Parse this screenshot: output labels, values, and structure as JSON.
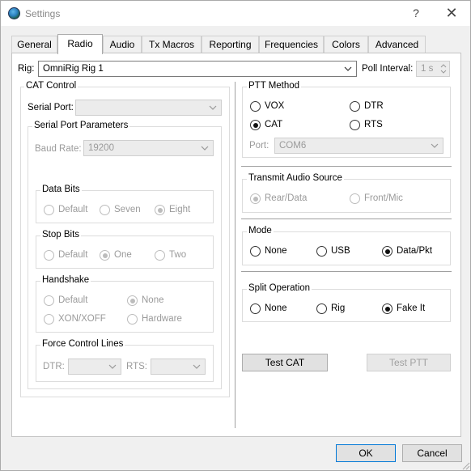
{
  "window": {
    "title": "Settings",
    "help_glyph": "?",
    "close_glyph": "✕",
    "icon": "globe-icon"
  },
  "tabs": [
    {
      "label": "General",
      "active": false
    },
    {
      "label": "Radio",
      "active": true
    },
    {
      "label": "Audio",
      "active": false
    },
    {
      "label": "Tx Macros",
      "active": false
    },
    {
      "label": "Reporting",
      "active": false
    },
    {
      "label": "Frequencies",
      "active": false
    },
    {
      "label": "Colors",
      "active": false
    },
    {
      "label": "Advanced",
      "active": false
    }
  ],
  "rig": {
    "label": "Rig:",
    "value": "OmniRig Rig 1",
    "poll_label": "Poll Interval:",
    "poll_value": "1 s"
  },
  "cat": {
    "title": "CAT Control",
    "serial_port_label": "Serial Port:",
    "serial_port_value": "",
    "params_title": "Serial Port Parameters",
    "baud_label": "Baud Rate:",
    "baud_value": "19200",
    "data_bits": {
      "title": "Data Bits",
      "options": [
        "Default",
        "Seven",
        "Eight"
      ],
      "selected": "Eight"
    },
    "stop_bits": {
      "title": "Stop Bits",
      "options": [
        "Default",
        "One",
        "Two"
      ],
      "selected": "One"
    },
    "handshake": {
      "title": "Handshake",
      "options": [
        "Default",
        "None",
        "XON/XOFF",
        "Hardware"
      ],
      "selected": "None"
    },
    "force": {
      "title": "Force Control Lines",
      "dtr_label": "DTR:",
      "rts_label": "RTS:",
      "dtr_value": "",
      "rts_value": ""
    }
  },
  "ptt": {
    "title": "PTT Method",
    "options": [
      "VOX",
      "DTR",
      "CAT",
      "RTS"
    ],
    "selected": "CAT",
    "port_label": "Port:",
    "port_value": "COM6"
  },
  "tx_audio": {
    "title": "Transmit Audio Source",
    "options": [
      "Rear/Data",
      "Front/Mic"
    ],
    "selected": "Rear/Data"
  },
  "mode": {
    "title": "Mode",
    "options": [
      "None",
      "USB",
      "Data/Pkt"
    ],
    "selected": "Data/Pkt"
  },
  "split": {
    "title": "Split Operation",
    "options": [
      "None",
      "Rig",
      "Fake It"
    ],
    "selected": "Fake It"
  },
  "buttons": {
    "test_cat": "Test CAT",
    "test_ptt": "Test PTT",
    "ok": "OK",
    "cancel": "Cancel"
  }
}
